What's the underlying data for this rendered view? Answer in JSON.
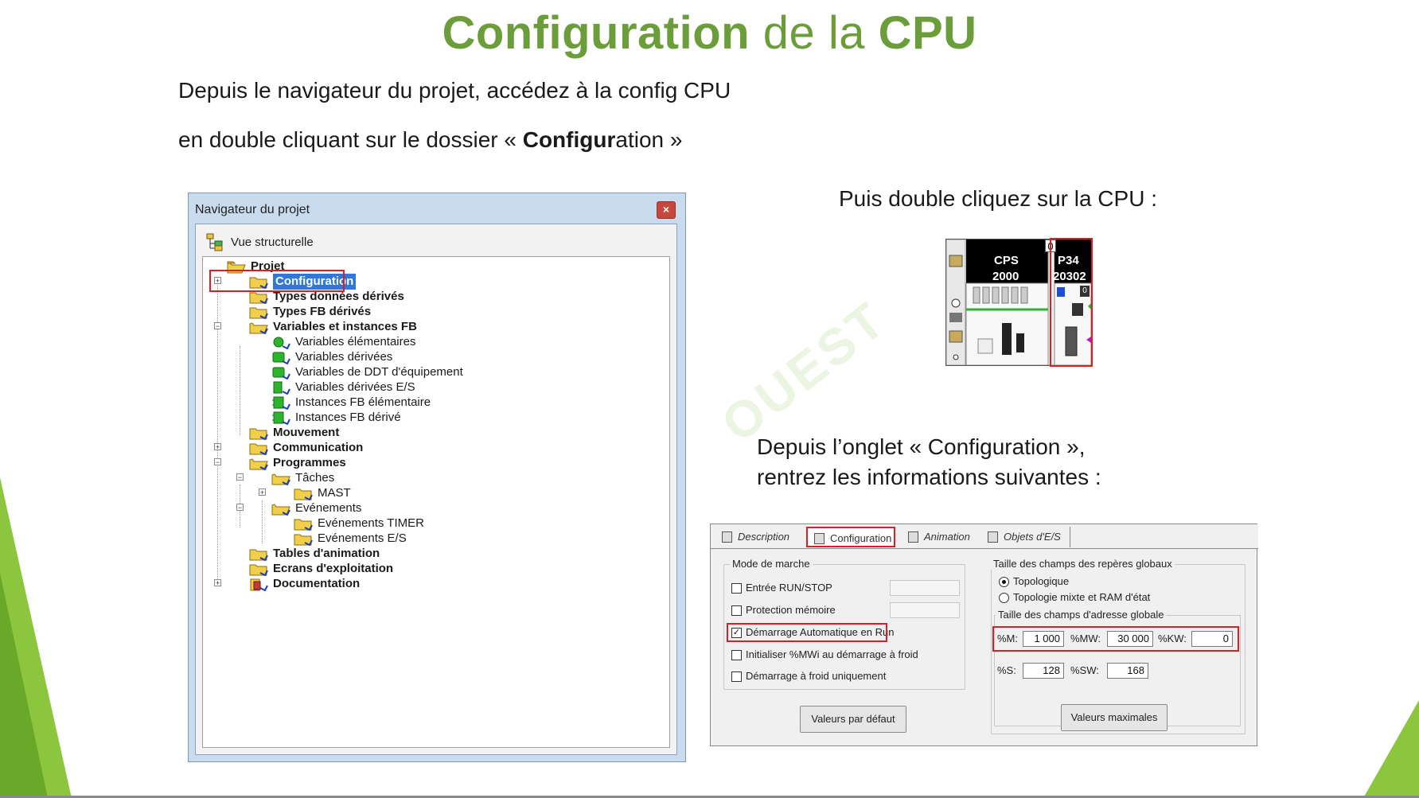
{
  "title": {
    "part1": "Configuration",
    "part2": " de la ",
    "part3": "CPU"
  },
  "intro": {
    "line1": "Depuis le navigateur du projet, accédez à la config CPU",
    "line2_prefix": "en double cliquant sur le dossier « ",
    "line2_bold": "Configu",
    "line2_bold2": "r",
    "line2_rest": "ation »"
  },
  "cpu_instruction": "Puis double cliquez sur la CPU :",
  "config_instruction": {
    "line1": "Depuis l’onglet « Configuration »,",
    "line2": "rentrez les informations suivantes :"
  },
  "watermark": "OUEST",
  "navigator": {
    "title": "Navigateur du projet",
    "close": "×",
    "view": "Vue structurelle",
    "tree": [
      {
        "label": "Projet",
        "bold": true
      },
      {
        "label": "Configuration",
        "bold": true,
        "selected": true
      },
      {
        "label": "Types données dérivés",
        "bold": true
      },
      {
        "label": "Types FB dérivés",
        "bold": true
      },
      {
        "label": "Variables et instances FB",
        "bold": true
      },
      {
        "label": "Variables élémentaires",
        "bold": false
      },
      {
        "label": "Variables dérivées",
        "bold": false
      },
      {
        "label": "Variables de DDT d'équipement",
        "bold": false
      },
      {
        "label": "Variables dérivées E/S",
        "bold": false
      },
      {
        "label": "Instances FB élémentaire",
        "bold": false
      },
      {
        "label": "Instances FB dérivé",
        "bold": false
      },
      {
        "label": "Mouvement",
        "bold": true
      },
      {
        "label": "Communication",
        "bold": true
      },
      {
        "label": "Programmes",
        "bold": true
      },
      {
        "label": "Tâches",
        "bold": false
      },
      {
        "label": "MAST",
        "bold": false
      },
      {
        "label": "Evénements",
        "bold": false
      },
      {
        "label": "Evénements TIMER",
        "bold": false
      },
      {
        "label": "Evénements E/S",
        "bold": false
      },
      {
        "label": "Tables d'animation",
        "bold": true
      },
      {
        "label": "Ecrans d'exploitation",
        "bold": true
      },
      {
        "label": "Documentation",
        "bold": true
      }
    ]
  },
  "cpu_module": {
    "slot": "0",
    "left_name": "CPS",
    "left_num": "2000",
    "right_name": "P34",
    "right_num": "20302",
    "right_badge": "0"
  },
  "config_panel": {
    "tabs": [
      "Description",
      "Configuration",
      "Animation",
      "Objets d'E/S"
    ],
    "mode_group": "Mode de marche",
    "mode_options": [
      {
        "label": "Entrée RUN/STOP",
        "checked": false
      },
      {
        "label": "Protection mémoire",
        "checked": false
      },
      {
        "label": "Démarrage Automatique en Run",
        "checked": true
      },
      {
        "label": "Initialiser %MWi au démarrage à froid",
        "checked": false
      },
      {
        "label": "Démarrage à froid uniquement",
        "checked": false
      }
    ],
    "fields_group": "Taille des champs des repères globaux",
    "radio_options": [
      {
        "label": "Topologique",
        "selected": true
      },
      {
        "label": "Topologie mixte et RAM d'état",
        "selected": false
      }
    ],
    "address_group": "Taille des champs d'adresse globale",
    "fields": {
      "m_label": "%M:",
      "m_value": "1 000",
      "mw_label": "%MW:",
      "mw_value": "30 000",
      "kw_label": "%KW:",
      "kw_value": "0",
      "s_label": "%S:",
      "s_value": "128",
      "sw_label": "%SW:",
      "sw_value": "168"
    },
    "btn_default": "Valeurs par défaut",
    "btn_max": "Valeurs maximales"
  }
}
